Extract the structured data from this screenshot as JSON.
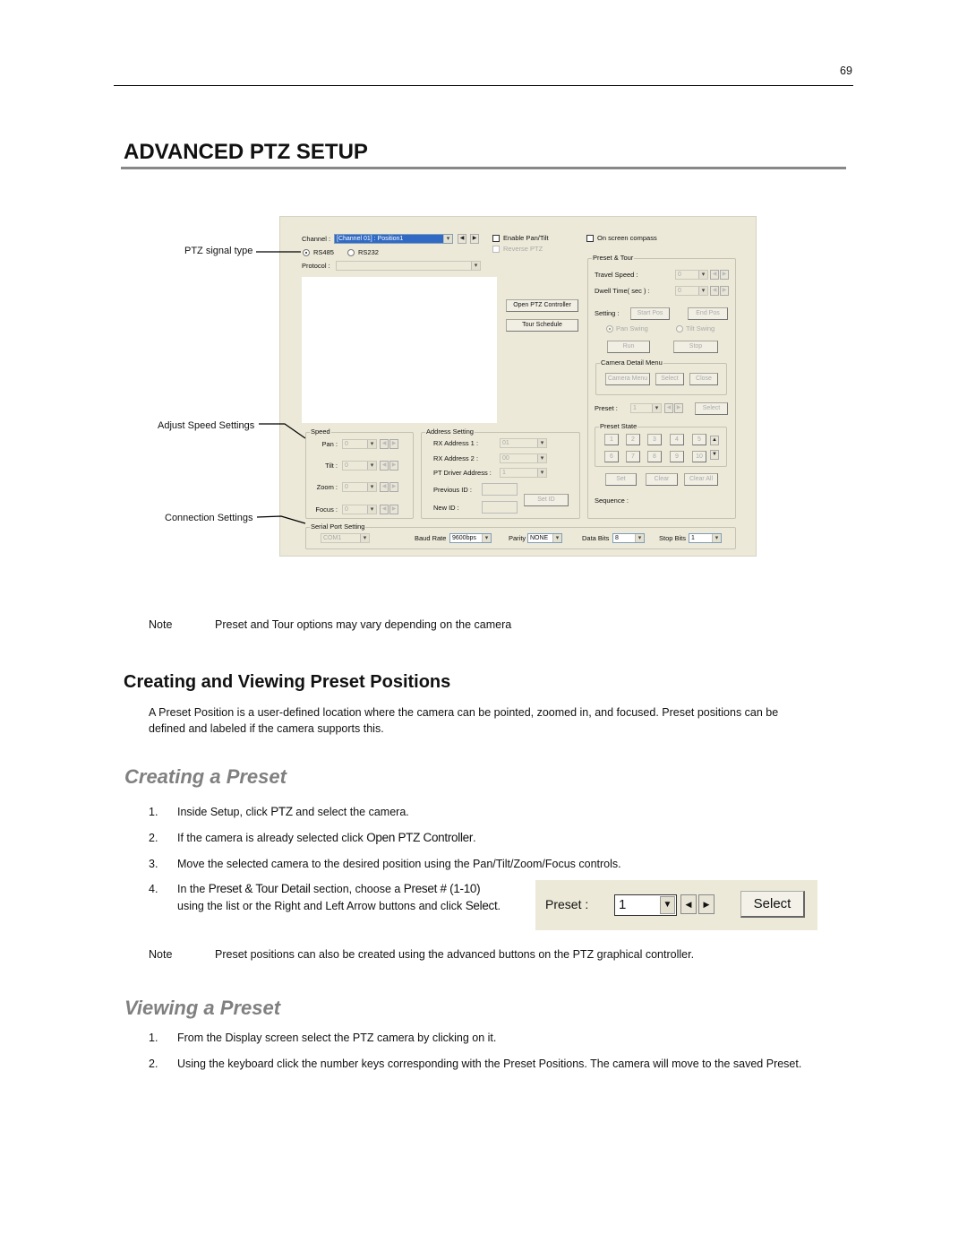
{
  "page_number": "69",
  "title": "ADVANCED PTZ SETUP",
  "callouts": {
    "signal": "PTZ signal type",
    "speed": "Adjust Speed Settings",
    "connection": "Connection Settings"
  },
  "dialog": {
    "channel_label": "Channel :",
    "channel_value": "[Channel 01] : Position1",
    "enable_pan_tilt": "Enable Pan/Tilt",
    "reverse_ptz": "Reverse PTZ",
    "on_screen_compass": "On screen compass",
    "rs485": "RS485",
    "rs232": "RS232",
    "protocol_label": "Protocol :",
    "open_ptz_controller": "Open PTZ Controller",
    "tour_schedule": "Tour Schedule",
    "preset_tour": {
      "title": "Preset & Tour",
      "travel_speed": "Travel Speed :",
      "travel_value": "0",
      "dwell_time": "Dwell Time( sec ) :",
      "dwell_value": "0",
      "setting": "Setting :",
      "start_pos": "Start Pos",
      "end_pos": "End Pos",
      "pan_swing": "Pan Swing",
      "tilt_swing": "Tilt Swing",
      "run": "Run",
      "stop": "Stop",
      "camera_detail_menu": "Camera Detail Menu",
      "camera_menu": "Camera Menu",
      "select": "Select",
      "close": "Close",
      "preset_label": "Preset :",
      "preset_value": "1",
      "preset_select": "Select",
      "preset_state": "Preset State",
      "preset_buttons": [
        "1",
        "2",
        "3",
        "4",
        "5",
        "6",
        "7",
        "8",
        "9",
        "10"
      ],
      "set": "Set",
      "clear": "Clear",
      "clear_all": "Clear All",
      "sequence": "Sequence :"
    },
    "speed": {
      "title": "Speed",
      "rows": [
        {
          "label": "Pan :",
          "value": "0"
        },
        {
          "label": "Tilt :",
          "value": "0"
        },
        {
          "label": "Zoom :",
          "value": "0"
        },
        {
          "label": "Focus :",
          "value": "0"
        }
      ]
    },
    "address": {
      "title": "Address Setting",
      "rx1": "RX Address 1 :",
      "rx1_value": "01",
      "rx2": "RX Address 2 :",
      "rx2_value": "00",
      "pt_driver": "PT Driver Address :",
      "pt_driver_value": "1",
      "previous_id": "Previous ID :",
      "new_id": "New ID :",
      "set_id": "Set ID"
    },
    "serial": {
      "title": "Serial Port Setting",
      "port": "COM1",
      "baud_label": "Baud Rate",
      "baud_value": "9600bps",
      "parity_label": "Parity",
      "parity_value": "NONE",
      "data_bits_label": "Data Bits",
      "data_bits_value": "8",
      "stop_bits_label": "Stop Bits",
      "stop_bits_value": "1"
    }
  },
  "note1": {
    "label": "Note",
    "text": "Preset and Tour options may vary depending on the camera"
  },
  "section": {
    "heading": "Creating and Viewing Preset Positions",
    "intro1": "A Preset Position is a user-defined location where the camera can be pointed, zoomed in, and focused.  Preset positions can be",
    "intro2": "defined and labeled if the camera supports this."
  },
  "creating": {
    "heading": "Creating a Preset",
    "s1": {
      "n": "1.",
      "a": "Inside Setup, click ",
      "b": "PTZ",
      "c": " and select the camera."
    },
    "s2": {
      "n": "2.",
      "a": "If the camera is already selected click ",
      "b": "Open PTZ Controller",
      "c": "."
    },
    "s3": {
      "n": "3.",
      "a": "Move the selected camera to the desired position using the Pan/Tilt/Zoom/Focus controls."
    },
    "s4": {
      "n": "4.",
      "a": "In the ",
      "b": "Preset & Tour Detail",
      "c": " section, choose a ",
      "d": "Preset # (1-10)",
      "e": "using the list or the Right and Left Arrow buttons and click ",
      "f": "Select",
      "g": "."
    },
    "widget": {
      "label": "Preset :",
      "value": "1",
      "button": "Select"
    }
  },
  "note2": {
    "label": "Note",
    "text": "Preset positions can also be created using the advanced buttons on the PTZ graphical controller."
  },
  "viewing": {
    "heading": "Viewing a Preset",
    "s1": {
      "n": "1.",
      "a": "From the Display screen select the PTZ camera by clicking on it."
    },
    "s2": {
      "n": "2.",
      "a": "Using the keyboard click the number keys corresponding with the Preset Positions.  The camera will move to the saved Preset."
    }
  }
}
